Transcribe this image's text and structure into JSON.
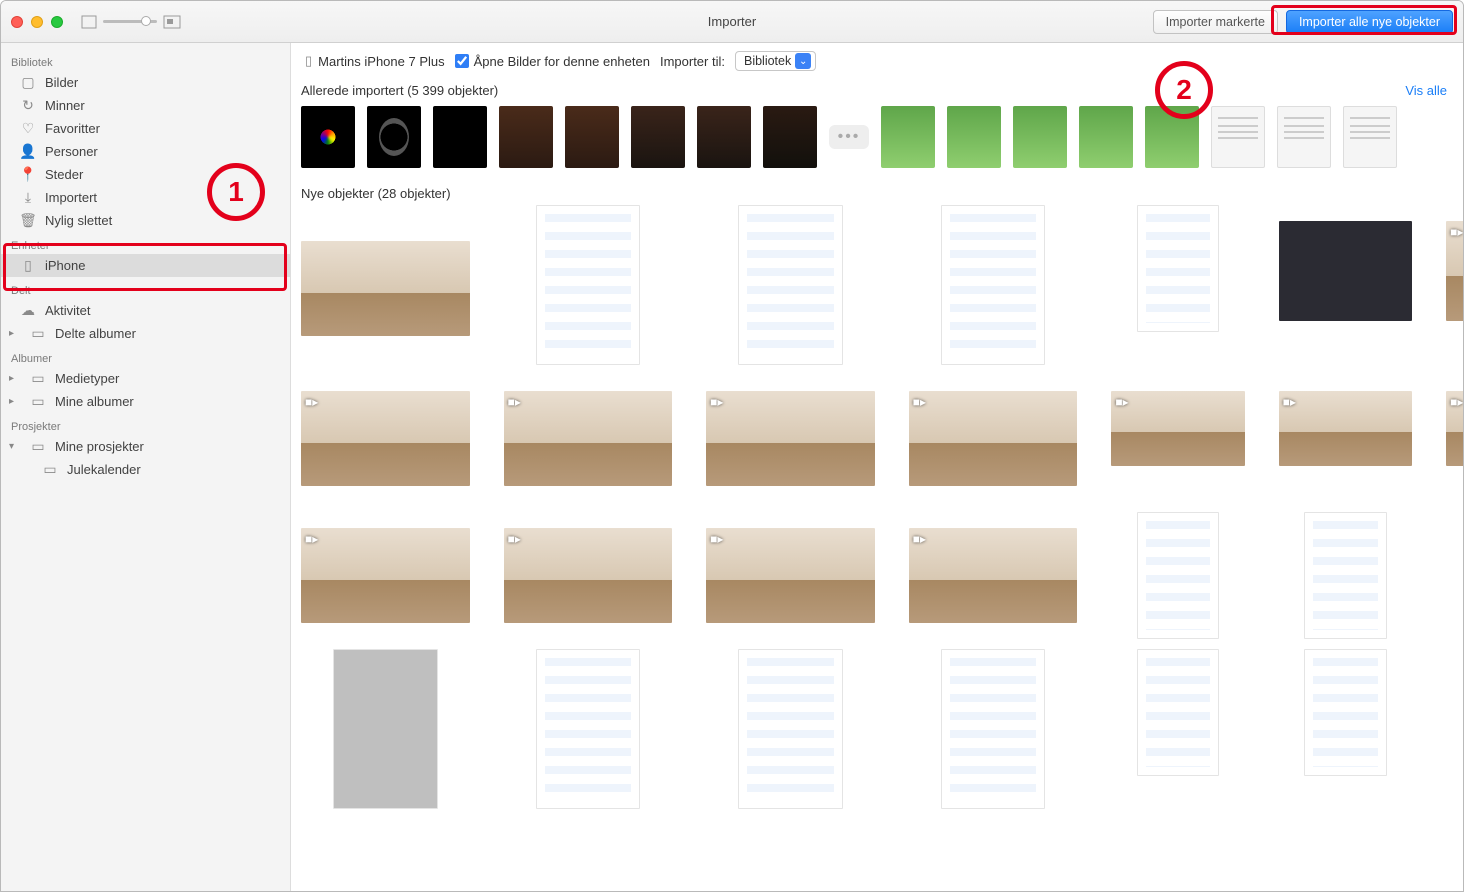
{
  "window": {
    "title": "Importer"
  },
  "toolbar": {
    "import_selected_label": "Importer markerte",
    "import_all_label": "Importer alle nye objekter"
  },
  "import_bar": {
    "device_name": "Martins iPhone 7 Plus",
    "open_photos_label": "Åpne Bilder for denne enheten",
    "import_to_label": "Importer til:",
    "import_to_value": "Bibliotek"
  },
  "sections": {
    "already": {
      "label": "Allerede importert (5 399 objekter)",
      "view_all": "Vis alle"
    },
    "new": {
      "label": "Nye objekter (28 objekter)"
    }
  },
  "sidebar": {
    "library_label": "Bibliotek",
    "library_items": [
      {
        "icon": "photos-icon",
        "label": "Bilder"
      },
      {
        "icon": "clock-icon",
        "label": "Minner"
      },
      {
        "icon": "heart-icon",
        "label": "Favoritter"
      },
      {
        "icon": "person-icon",
        "label": "Personer"
      },
      {
        "icon": "pin-icon",
        "label": "Steder"
      },
      {
        "icon": "download-icon",
        "label": "Importert"
      },
      {
        "icon": "trash-icon",
        "label": "Nylig slettet"
      }
    ],
    "devices_label": "Enheter",
    "devices": [
      {
        "icon": "iphone-icon",
        "label": "iPhone",
        "selected": true
      }
    ],
    "shared_label": "Delt",
    "shared_items": [
      {
        "icon": "cloud-icon",
        "label": "Aktivitet"
      },
      {
        "icon": "album-icon",
        "label": "Delte albumer",
        "disclosure": true
      }
    ],
    "albums_label": "Albumer",
    "albums_items": [
      {
        "icon": "album-icon",
        "label": "Medietyper",
        "disclosure": true
      },
      {
        "icon": "album-icon",
        "label": "Mine albumer",
        "disclosure": true
      }
    ],
    "projects_label": "Prosjekter",
    "projects_items": [
      {
        "icon": "album-icon",
        "label": "Mine prosjekter",
        "disclosure": true,
        "open": true
      },
      {
        "icon": "album-icon",
        "label": "Julekalender",
        "indent": true
      }
    ]
  },
  "annotations": {
    "1": "1",
    "2": "2"
  }
}
